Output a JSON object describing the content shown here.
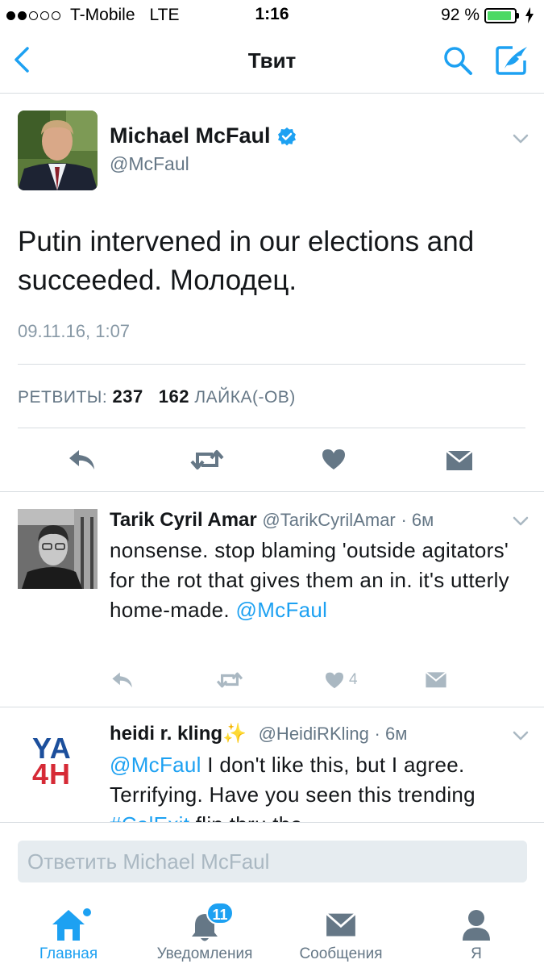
{
  "status_bar": {
    "carrier": "T-Mobile",
    "network": "LTE",
    "time": "1:16",
    "battery": "92 %",
    "battery_level": 0.92,
    "signal_bars_filled": 2,
    "signal_bars_total": 5
  },
  "nav": {
    "title": "Твит",
    "back_icon": "chevron-left-icon",
    "search_icon": "search-icon",
    "compose_icon": "compose-tweet-icon"
  },
  "tweet": {
    "author_name": "Michael McFaul",
    "verified": true,
    "handle": "@McFaul",
    "text": "Putin intervened in our elections and succeeded. Молодец.",
    "date": "09.11.16, 1:07",
    "retweets_label": "РЕТВИТЫ:",
    "retweets_count": "237",
    "likes_count": "162",
    "likes_label": "ЛАЙКА(-ОВ)"
  },
  "replies": [
    {
      "name": "Tarik Cyril Amar",
      "handle": "@TarikCyrilAmar",
      "time": "· 6м",
      "text": "nonsense. stop blaming 'outside agitators' for the rot that gives them an in. it's utterly home-made.",
      "mention": "@McFaul",
      "like_count": "4"
    },
    {
      "name": "heidi r. kling",
      "emoji": "✨",
      "handle": "@HeidiRKling",
      "time": "· 6м",
      "mention": "@McFaul",
      "text": "I don't like this, but I agree. Terrifying. Have you seen this",
      "text_partial_a": "trending",
      "hashtag": "#CalExit",
      "text_partial_b": "flip thru the",
      "avatar_text_top": "YA",
      "avatar_text_bottom": "4H"
    }
  ],
  "reply_bar": {
    "placeholder": "Ответить Michael McFaul"
  },
  "tabs": [
    {
      "label": "Главная",
      "icon": "home-icon",
      "active": true
    },
    {
      "label": "Уведомления",
      "icon": "bell-icon",
      "badge": "11"
    },
    {
      "label": "Сообщения",
      "icon": "envelope-icon"
    },
    {
      "label": "Я",
      "icon": "profile-icon"
    }
  ],
  "colors": {
    "accent": "#1da1f2",
    "muted": "#657786",
    "icon_gray": "#657786",
    "battery": "#4cd964"
  }
}
